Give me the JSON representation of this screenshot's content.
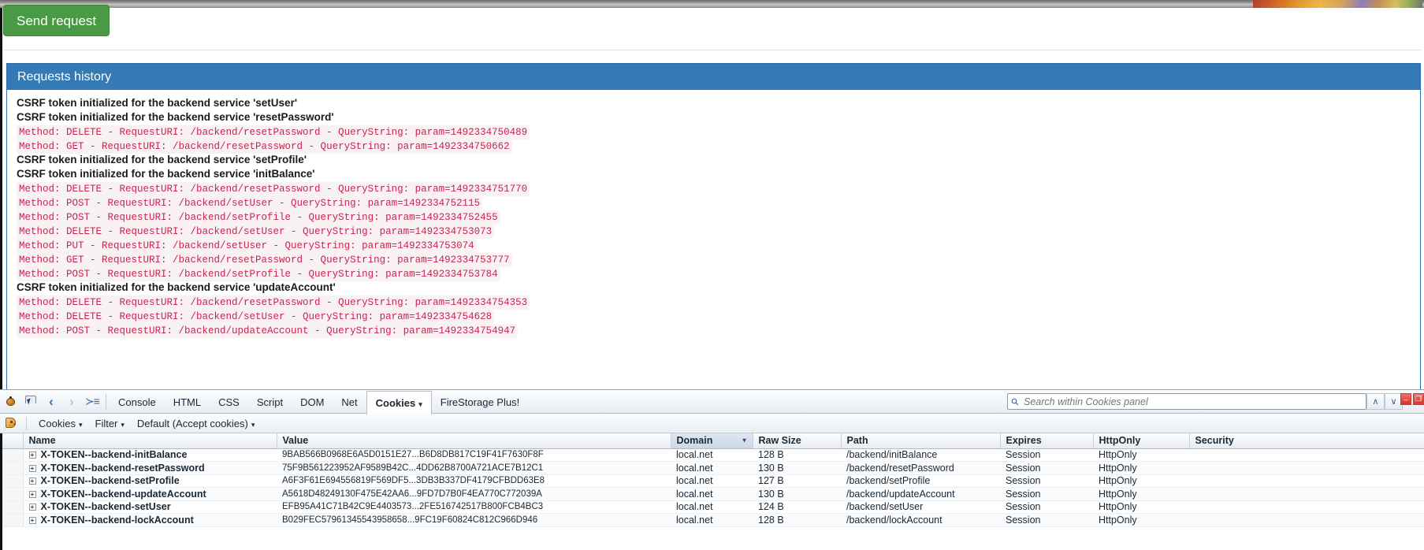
{
  "page": {
    "send_button_label": "Send request",
    "history_panel_title": "Requests history",
    "log_lines": [
      {
        "type": "csrf",
        "text": "CSRF token initialized for the backend service 'setUser'"
      },
      {
        "type": "csrf",
        "text": "CSRF token initialized for the backend service 'resetPassword'"
      },
      {
        "type": "req",
        "text": "Method: DELETE - RequestURI: /backend/resetPassword - QueryString: param=1492334750489"
      },
      {
        "type": "req",
        "text": "Method: GET - RequestURI: /backend/resetPassword - QueryString: param=1492334750662"
      },
      {
        "type": "csrf",
        "text": "CSRF token initialized for the backend service 'setProfile'"
      },
      {
        "type": "csrf",
        "text": "CSRF token initialized for the backend service 'initBalance'"
      },
      {
        "type": "req",
        "text": "Method: DELETE - RequestURI: /backend/resetPassword - QueryString: param=1492334751770"
      },
      {
        "type": "req",
        "text": "Method: POST - RequestURI: /backend/setUser - QueryString: param=1492334752115"
      },
      {
        "type": "req",
        "text": "Method: POST - RequestURI: /backend/setProfile - QueryString: param=1492334752455"
      },
      {
        "type": "req",
        "text": "Method: DELETE - RequestURI: /backend/setUser - QueryString: param=1492334753073"
      },
      {
        "type": "req",
        "text": "Method: PUT - RequestURI: /backend/setUser - QueryString: param=1492334753074"
      },
      {
        "type": "req",
        "text": "Method: GET - RequestURI: /backend/resetPassword - QueryString: param=1492334753777"
      },
      {
        "type": "req",
        "text": "Method: POST - RequestURI: /backend/setProfile - QueryString: param=1492334753784"
      },
      {
        "type": "csrf",
        "text": "CSRF token initialized for the backend service 'updateAccount'"
      },
      {
        "type": "req",
        "text": "Method: DELETE - RequestURI: /backend/resetPassword - QueryString: param=1492334754353"
      },
      {
        "type": "req",
        "text": "Method: DELETE - RequestURI: /backend/setUser - QueryString: param=1492334754628"
      },
      {
        "type": "req",
        "text": "Method: POST - RequestURI: /backend/updateAccount - QueryString: param=1492334754947"
      }
    ]
  },
  "firebug": {
    "tabs": [
      {
        "label": "Console",
        "active": false,
        "has_caret": false
      },
      {
        "label": "HTML",
        "active": false,
        "has_caret": false
      },
      {
        "label": "CSS",
        "active": false,
        "has_caret": false
      },
      {
        "label": "Script",
        "active": false,
        "has_caret": false
      },
      {
        "label": "DOM",
        "active": false,
        "has_caret": false
      },
      {
        "label": "Net",
        "active": false,
        "has_caret": false
      },
      {
        "label": "Cookies",
        "active": true,
        "has_caret": true
      },
      {
        "label": "FireStorage Plus!",
        "active": false,
        "has_caret": false
      }
    ],
    "search": {
      "placeholder": "Search within Cookies panel",
      "value": ""
    },
    "nav": {
      "prev_label": "∧",
      "next_label": "∨"
    },
    "window_buttons": [
      "–",
      "❐"
    ],
    "subtoolbar": [
      {
        "label": "Cookies",
        "has_caret": true
      },
      {
        "label": "Filter",
        "has_caret": true
      },
      {
        "label": "Default (Accept cookies)",
        "has_caret": true
      }
    ],
    "table": {
      "columns": [
        {
          "label": "Name",
          "sorted": false
        },
        {
          "label": "Value",
          "sorted": false
        },
        {
          "label": "Domain",
          "sorted": true
        },
        {
          "label": "Raw Size",
          "sorted": false
        },
        {
          "label": "Path",
          "sorted": false
        },
        {
          "label": "Expires",
          "sorted": false
        },
        {
          "label": "HttpOnly",
          "sorted": false
        },
        {
          "label": "Security",
          "sorted": false
        }
      ],
      "sort_indicator": "▼",
      "expander_glyph": "+",
      "rows": [
        {
          "name": "X-TOKEN--backend-initBalance",
          "value": "9BAB566B0968E6A5D0151E27...B6D8DB817C19F41F7630F8F",
          "domain": "local.net",
          "raw_size": "128 B",
          "path": "/backend/initBalance",
          "expires": "Session",
          "httponly": "HttpOnly",
          "security": ""
        },
        {
          "name": "X-TOKEN--backend-resetPassword",
          "value": "75F9B561223952AF9589B42C...4DD62B8700A721ACE7B12C1",
          "domain": "local.net",
          "raw_size": "130 B",
          "path": "/backend/resetPassword",
          "expires": "Session",
          "httponly": "HttpOnly",
          "security": ""
        },
        {
          "name": "X-TOKEN--backend-setProfile",
          "value": "A6F3F61E694556819F569DF5...3DB3B337DF4179CFBDD63E8",
          "domain": "local.net",
          "raw_size": "127 B",
          "path": "/backend/setProfile",
          "expires": "Session",
          "httponly": "HttpOnly",
          "security": ""
        },
        {
          "name": "X-TOKEN--backend-updateAccount",
          "value": "A5618D48249130F475E42AA6...9FD7D7B0F4EA770C772039A",
          "domain": "local.net",
          "raw_size": "130 B",
          "path": "/backend/updateAccount",
          "expires": "Session",
          "httponly": "HttpOnly",
          "security": ""
        },
        {
          "name": "X-TOKEN--backend-setUser",
          "value": "EFB95A41C71B42C9E4403573...2FE516742517B800FCB4BC3",
          "domain": "local.net",
          "raw_size": "124 B",
          "path": "/backend/setUser",
          "expires": "Session",
          "httponly": "HttpOnly",
          "security": ""
        },
        {
          "name": "X-TOKEN--backend-lockAccount",
          "value": "B029FEC57961345543958658...9FC19F60824C812C966D946",
          "domain": "local.net",
          "raw_size": "128 B",
          "path": "/backend/lockAccount",
          "expires": "Session",
          "httponly": "HttpOnly",
          "security": ""
        }
      ]
    }
  },
  "colors": {
    "accent_blue": "#337ab7",
    "green_button": "#4a9a45",
    "log_request_text": "#c7254e",
    "log_request_bg": "#f9f2f4",
    "domain_link": "#1a4fd6",
    "session_green": "#1f8a2e"
  }
}
